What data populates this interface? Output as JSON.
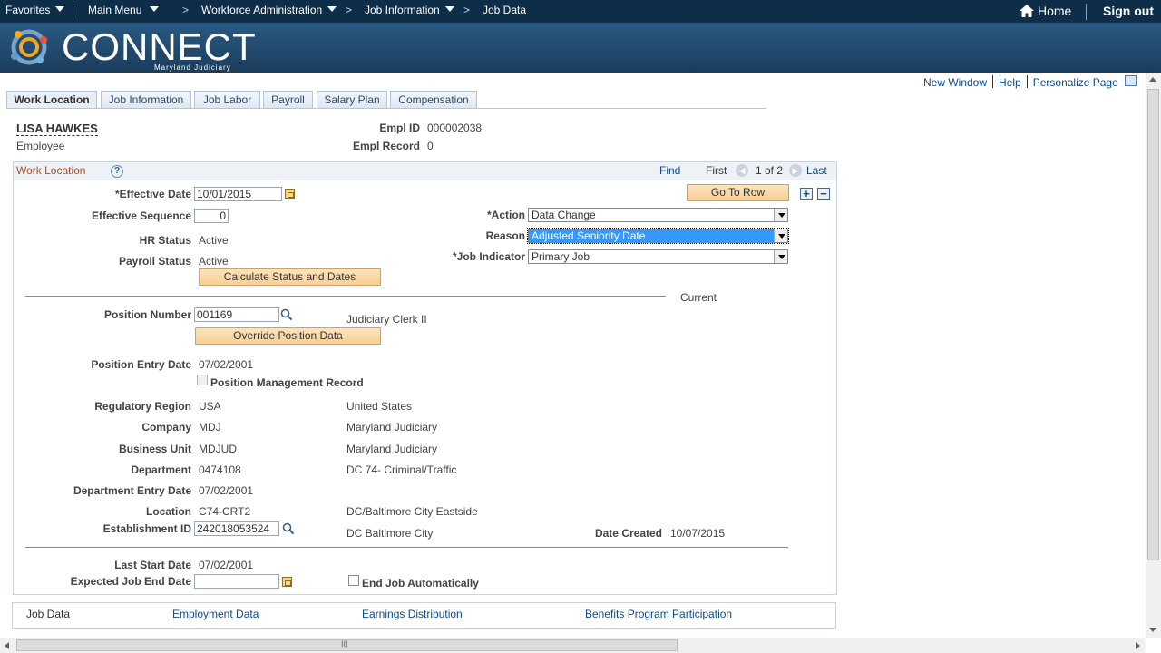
{
  "topnav": {
    "favorites": "Favorites",
    "main_menu": "Main Menu",
    "workforce_admin": "Workforce Administration",
    "job_information": "Job Information",
    "job_data": "Job Data",
    "separator": ">",
    "home": "Home",
    "sign_out": "Sign out"
  },
  "banner": {
    "logo": "CONNECT",
    "subtitle": "Maryland Judiciary"
  },
  "utility": {
    "new_window": "New Window",
    "help": "Help",
    "personalize": "Personalize Page"
  },
  "tabs": [
    "Work Location",
    "Job Information",
    "Job Labor",
    "Payroll",
    "Salary Plan",
    "Compensation"
  ],
  "employee": {
    "name": "LISA HAWKES",
    "type": "Employee",
    "empl_id_label": "Empl ID",
    "empl_id": "000002038",
    "empl_record_label": "Empl Record",
    "empl_record": "0"
  },
  "group": {
    "title": "Work Location",
    "help": "?",
    "find": "Find",
    "first": "First",
    "count": "1 of 2",
    "last": "Last"
  },
  "form": {
    "effective_date_label": "*Effective Date",
    "effective_date": "10/01/2015",
    "effective_seq_label": "Effective Sequence",
    "effective_seq": "0",
    "hr_status_label": "HR Status",
    "hr_status": "Active",
    "payroll_status_label": "Payroll Status",
    "payroll_status": "Active",
    "calc_button": "Calculate Status and Dates",
    "go_to_row": "Go To Row",
    "action_label": "*Action",
    "action": "Data Change",
    "reason_label": "Reason",
    "reason": "Adjusted Seniority Date",
    "job_indicator_label": "*Job Indicator",
    "job_indicator": "Primary Job",
    "current": "Current",
    "position_number_label": "Position Number",
    "position_number": "001169",
    "position_desc": "Judiciary Clerk II",
    "override_button": "Override Position Data",
    "position_entry_date_label": "Position Entry Date",
    "position_entry_date": "07/02/2001",
    "position_mgmt_record": "Position Management Record",
    "regulatory_region_label": "Regulatory Region",
    "regulatory_region": "USA",
    "regulatory_region_desc": "United States",
    "company_label": "Company",
    "company": "MDJ",
    "company_desc": "Maryland Judiciary",
    "business_unit_label": "Business Unit",
    "business_unit": "MDJUD",
    "business_unit_desc": "Maryland Judiciary",
    "department_label": "Department",
    "department": "0474108",
    "department_desc": "DC 74- Criminal/Traffic",
    "dept_entry_date_label": "Department Entry Date",
    "dept_entry_date": "07/02/2001",
    "location_label": "Location",
    "location": "C74-CRT2",
    "location_desc": "DC/Baltimore City Eastside",
    "establishment_id_label": "Establishment ID",
    "establishment_id": "242018053524",
    "establishment_desc": "DC Baltimore City",
    "date_created_label": "Date Created",
    "date_created": "10/07/2015",
    "last_start_date_label": "Last Start Date",
    "last_start_date": "07/02/2001",
    "expected_end_label": "Expected Job End Date",
    "expected_end": "",
    "end_job_auto": "End Job Automatically"
  },
  "bottom_links": {
    "job_data": "Job Data",
    "employment_data": "Employment Data",
    "earnings_distribution": "Earnings Distribution",
    "benefits": "Benefits Program Participation"
  },
  "scrollbar": {
    "grip": "III"
  },
  "colors": {
    "topnav": "#0e2d49",
    "banner": "#1f4a70",
    "link": "#0a4a8a",
    "button": "#f7cf95",
    "highlight": "#3399ff"
  }
}
